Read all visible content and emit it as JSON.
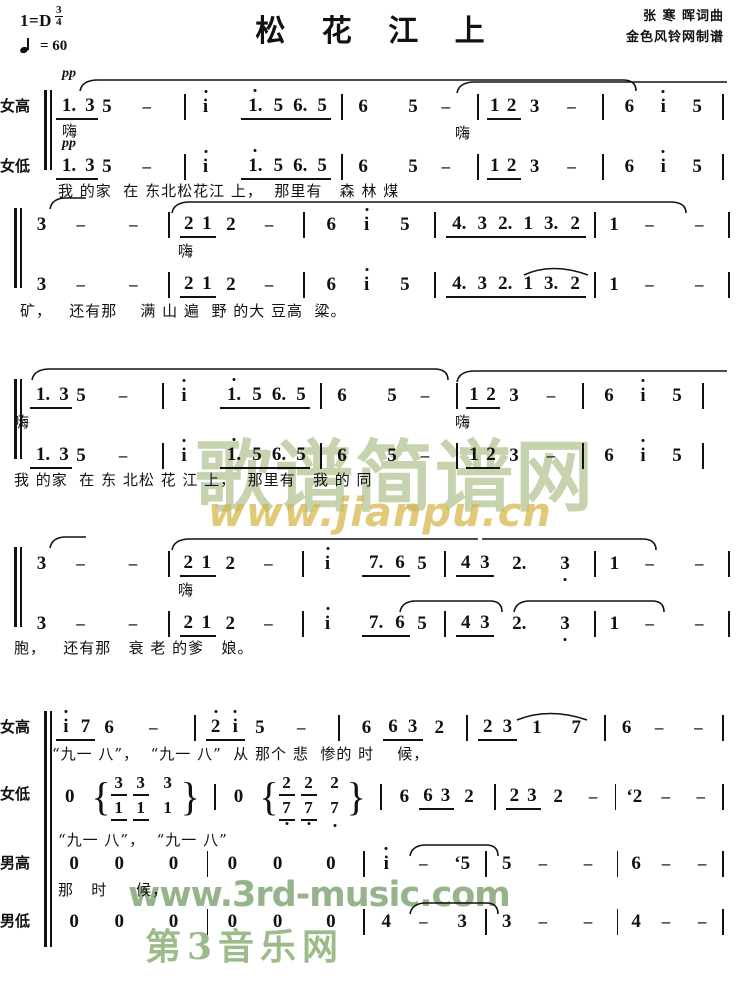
{
  "header": {
    "key_signature": "1=D",
    "meter_num": "3",
    "meter_den": "4",
    "tempo_value": "= 60",
    "title": "松 花 江 上",
    "credit_1": "张 寒 晖词曲",
    "credit_2": "金色风铃网制谱"
  },
  "watermarks": {
    "jianpu_cn": "歌谱简谱网",
    "jianpu_url": "www.jianpu.cn",
    "third_music_url": "www.3rd-music.com",
    "third_music_cn": "第3音乐网"
  },
  "voices": {
    "soprano": "女高",
    "alto": "女低",
    "tenor": "男高",
    "bass": "男低"
  },
  "dynamics": {
    "pp": "pp"
  },
  "vocalise": {
    "hum": "嗨"
  },
  "systems": [
    {
      "id": "system-1",
      "soprano_notes": "1. 3 5  –  | i  1. 5 6. 5 | 6  5  –  | 1 2  3  –  | 6  i  5 |",
      "alto_notes": "1. 3 5  –  | i  1. 5 6. 5 | 6  5  –  | 1 2  3  –  | 6  i  5 |",
      "lyrics": "我 的家  在 东北松花江 上，  那里有   森 林 煤"
    },
    {
      "id": "system-2",
      "soprano_notes": "3  –  –  | 2 1  2  –  | 6  i  5 | 4. 3 2. 1 3. 2 | 1  –  – |",
      "alto_notes": "3  –  –  | 2 1  2  –  | 6  i  5 | 4. 3 2. 1 3. 2 | 1  –  – |",
      "lyrics": "矿，   还有那    满 山 遍  野 的大 豆高  粱。"
    },
    {
      "id": "system-3",
      "soprano_notes": "1. 3 5  –  | i  1. 5 6. 5 | 6  5  –  | 1 2  3  –  | 6  i  5 |",
      "alto_notes": "1. 3 5  –  | i  1. 5 6. 5 | 6  5  –  | 1 2  3  –  | 6  i  5 |",
      "lyrics": "我 的家  在 东 北松 花 江 上，  那里有   我 的 同"
    },
    {
      "id": "system-4",
      "soprano_notes": "3  –  –  | 2 1  2  –  | i  7. 6 5 | 4 3  2.  3 | 1  –  – |",
      "alto_notes": "3  –  –  | 2 1  2  –  | i  7. 6 5 | 4 3  2.  3 | 1  –  – |",
      "lyrics": "胞，   还有那   衰 老 的爹   娘。"
    },
    {
      "id": "system-5",
      "soprano_notes": "i 7 6  –  | 2 i 5  –  | 6  6 3 2 | 2 3  1  7 | 6  –  – |",
      "soprano_lyrics": "“九一 八”，  “九一 八”  从 那个 悲  惨的 时    候，",
      "alto_chords": "0 {3 3 3 / 1 1 1} | 0 {2 2 2 / 7 7 7} | 6  6 3 2 | 2 3 2  – | ʻ2  –  – |",
      "alto_lyrics": "“九一 八”，  “九一 八”",
      "tenor_notes": "0 0 0 | 0 0 0 | i  –  ʻ5 | 5  –  – | 6  –  – |",
      "tenor_lyrics": "那   时     候，",
      "bass_notes": "0 0 0 | 0 0 0 | 4  –  3 | 3  –  – | 4  –  – |"
    }
  ]
}
